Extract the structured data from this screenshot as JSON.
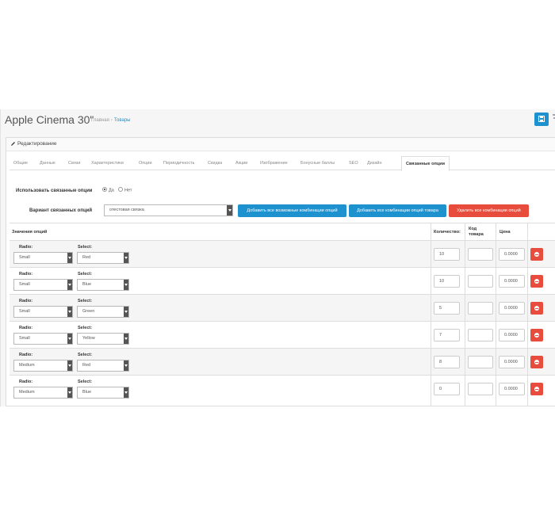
{
  "header": {
    "title": "Apple Cinema 30\"",
    "breadcrumb": [
      {
        "label": "Главная"
      },
      {
        "label": "Товары"
      }
    ],
    "breadcrumb_separator": "›"
  },
  "panel": {
    "heading": "Редактирование"
  },
  "tabs": [
    {
      "label": "Общие"
    },
    {
      "label": "Данные"
    },
    {
      "label": "Связи"
    },
    {
      "label": "Характеристики"
    },
    {
      "label": "Опции"
    },
    {
      "label": "Периодичность"
    },
    {
      "label": "Скидка"
    },
    {
      "label": "Акции"
    },
    {
      "label": "Изображение"
    },
    {
      "label": "Бонусные баллы"
    },
    {
      "label": "SEO"
    },
    {
      "label": "Дизайн"
    },
    {
      "label": "Связанные опции",
      "active": true
    }
  ],
  "form": {
    "use_related_label": "Использовать связанные опции",
    "yes_label": "Да",
    "no_label": "Нет",
    "variant_label": "Вариант связанных опций",
    "variant_value": "отестовая связка",
    "btn_add_all": "Добавить все возможные комбинации опций",
    "btn_add_product": "Добавить все комбинации опций товара",
    "btn_delete_all": "Удалить все комбинации опций"
  },
  "table": {
    "headers": {
      "values": "Значения опций",
      "qty": "Количество:",
      "code_line1": "Код",
      "code_line2": "товара",
      "price": "Цена"
    },
    "radio_label": "Radio:",
    "select_label": "Select:",
    "rows": [
      {
        "radio": "Small",
        "select": "Red",
        "qty": "10",
        "code": "",
        "price": "0.0000"
      },
      {
        "radio": "Small",
        "select": "Blue",
        "qty": "10",
        "code": "",
        "price": "0.0000"
      },
      {
        "radio": "Small",
        "select": "Green",
        "qty": "5",
        "code": "",
        "price": "0.0000"
      },
      {
        "radio": "Small",
        "select": "Yellow",
        "qty": "7",
        "code": "",
        "price": "0.0000"
      },
      {
        "radio": "Medium",
        "select": "Red",
        "qty": "8",
        "code": "",
        "price": "0.0000"
      },
      {
        "radio": "Medium",
        "select": "Blue",
        "qty": "0",
        "code": "",
        "price": "0.0000"
      }
    ]
  },
  "colors": {
    "primary": "#1e91cf",
    "danger": "#e74c3c"
  }
}
